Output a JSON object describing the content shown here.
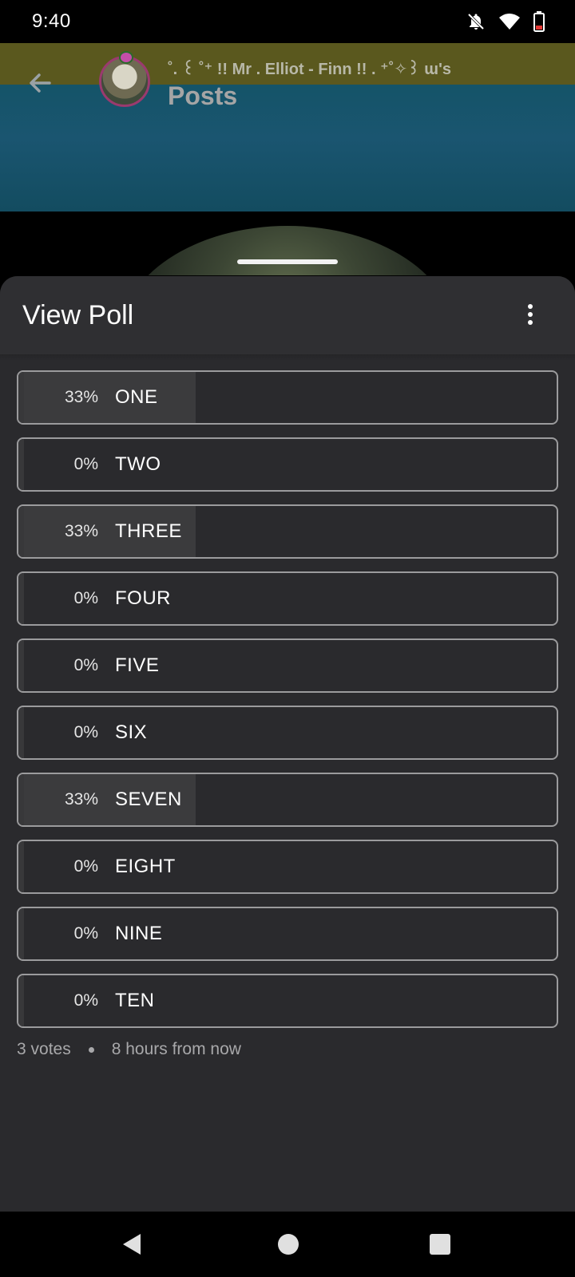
{
  "status_bar": {
    "time": "9:40",
    "icons": [
      "notifications-off-icon",
      "wifi-icon",
      "battery-icon"
    ]
  },
  "header": {
    "title": "˚. ꒰ ˚⁺ !! Mr . Elliot - Finn !! . ⁺˚✧꒱ ɯ's",
    "subtitle": "Posts"
  },
  "sheet": {
    "title": "View Poll",
    "menu_icon": "more-vertical-icon"
  },
  "poll": {
    "options": [
      {
        "percent": "33%",
        "label": "ONE",
        "share": 0.33
      },
      {
        "percent": "0%",
        "label": "TWO",
        "share": 0
      },
      {
        "percent": "33%",
        "label": "THREE",
        "share": 0.33
      },
      {
        "percent": "0%",
        "label": "FOUR",
        "share": 0
      },
      {
        "percent": "0%",
        "label": "FIVE",
        "share": 0
      },
      {
        "percent": "0%",
        "label": "SIX",
        "share": 0
      },
      {
        "percent": "33%",
        "label": "SEVEN",
        "share": 0.33
      },
      {
        "percent": "0%",
        "label": "EIGHT",
        "share": 0
      },
      {
        "percent": "0%",
        "label": "NINE",
        "share": 0
      },
      {
        "percent": "0%",
        "label": "TEN",
        "share": 0
      }
    ],
    "votes": "3 votes",
    "time_left": "8 hours from now"
  },
  "colors": {
    "sheet_bg": "#2a2a2d",
    "option_border": "#9b9b9d",
    "option_fill": "#3b3b3d"
  }
}
